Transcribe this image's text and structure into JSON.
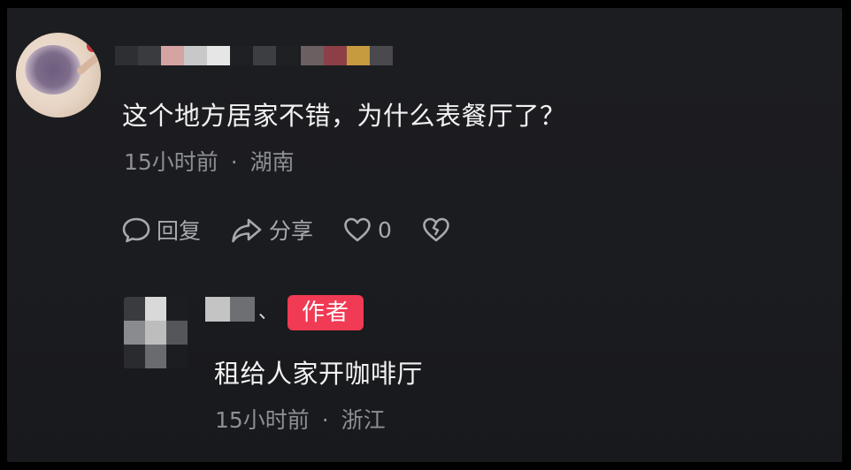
{
  "comment": {
    "text": "这个地方居家不错，为什么表餐厅了？",
    "time": "15小时前",
    "separator": "·",
    "location": "湖南",
    "actions": {
      "reply_label": "回复",
      "share_label": "分享",
      "like_count": "0"
    },
    "icons": [
      "comment-bubble-icon",
      "share-arrow-icon",
      "heart-icon",
      "broken-heart-icon"
    ]
  },
  "reply": {
    "badge": "作者",
    "text": "租给人家开咖啡厅",
    "time": "15小时前",
    "separator": "·",
    "location": "浙江"
  },
  "colors": {
    "background": "#1b1c20",
    "primary_text": "#f2f2f2",
    "secondary_text": "#8e8f94",
    "badge": "#f13a54"
  }
}
